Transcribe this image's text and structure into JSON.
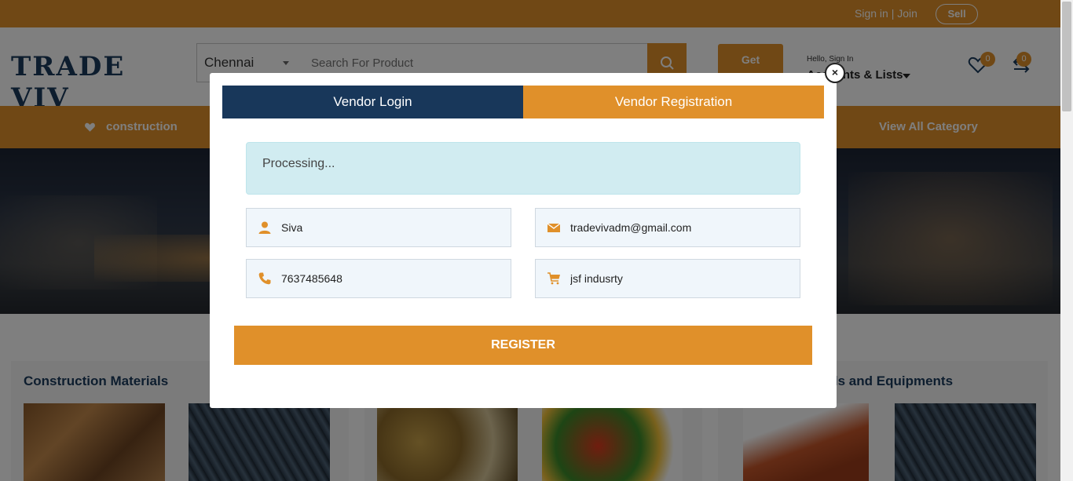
{
  "topbar": {
    "signin_join": "Sign in | Join",
    "sell_label": "Sell"
  },
  "header": {
    "logo_text": "TRADE VIV",
    "city": "Chennai",
    "search_placeholder": "Search For Product",
    "get_quote": "Get",
    "hello": "Hello, Sign In",
    "accounts": "Accounts & Lists",
    "wishlist_count": "0",
    "compare_count": "0"
  },
  "category_bar": {
    "first_category": "construction",
    "view_all": "View All Category"
  },
  "sections": {
    "left_title": "Construction Materials",
    "right_title": "terials and Equipments"
  },
  "modal": {
    "tab_login": "Vendor Login",
    "tab_register": "Vendor Registration",
    "alert_text": "Processing...",
    "name_value": "Siva",
    "email_value": "tradevivadm@gmail.com",
    "phone_value": "7637485648",
    "company_value": "jsf indusrty",
    "register_label": "REGISTER",
    "close_symbol": "×"
  },
  "colors": {
    "brand_orange": "#e0902a",
    "brand_navy": "#18375a",
    "alert_bg": "#d1ecf1"
  }
}
